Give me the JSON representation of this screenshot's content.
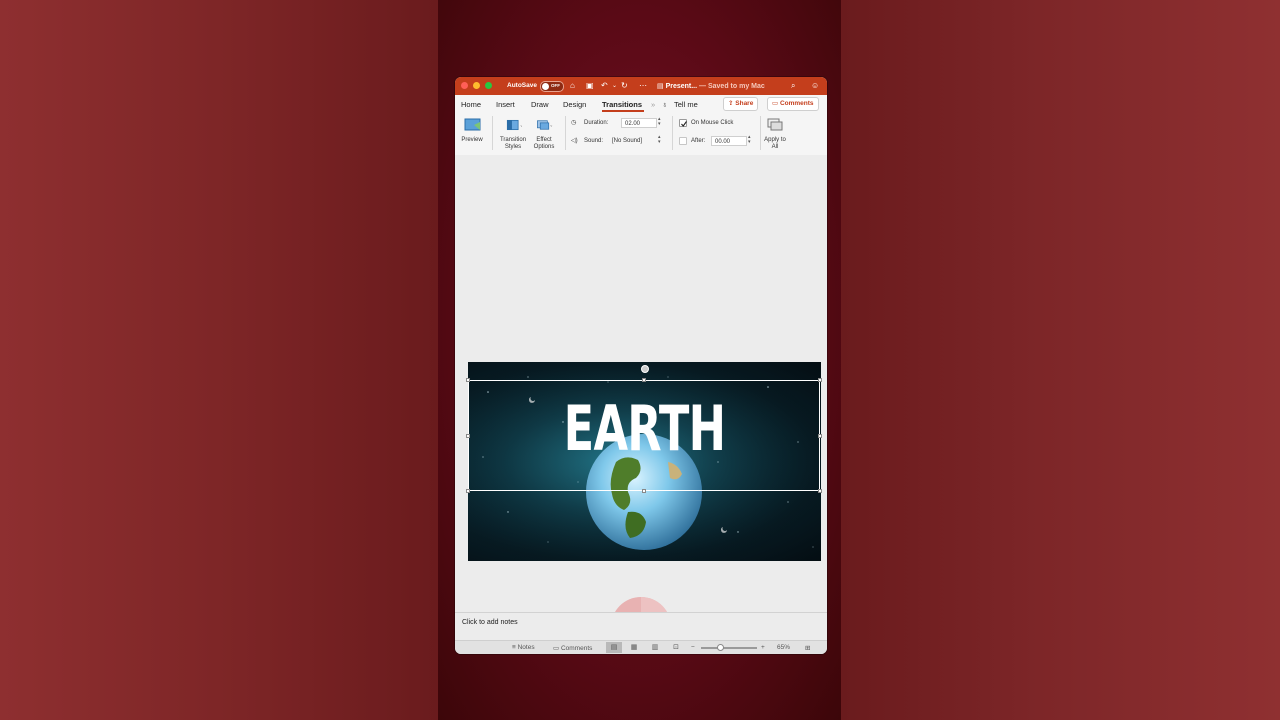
{
  "titlebar": {
    "autosave_label": "AutoSave",
    "autosave_state": "OFF",
    "doc_name": "Present...",
    "save_status": "— Saved to my Mac"
  },
  "tabs": [
    {
      "label": "Home"
    },
    {
      "label": "Insert"
    },
    {
      "label": "Draw"
    },
    {
      "label": "Design"
    },
    {
      "label": "Transitions",
      "active": true
    }
  ],
  "tell_me": "Tell me",
  "share_label": "Share",
  "comments_label": "Comments",
  "ribbon": {
    "preview_label": "Preview",
    "transition_styles_label": "Transition Styles",
    "effect_options_label": "Effect Options",
    "duration_label": "Duration:",
    "duration_value": "02.00",
    "sound_label": "Sound:",
    "sound_value": "[No Sound]",
    "on_mouse_click_label": "On Mouse Click",
    "on_mouse_click_checked": true,
    "after_label": "After:",
    "after_value": "00.00",
    "after_checked": false,
    "apply_all_label": "Apply to All"
  },
  "slide": {
    "title": "EARTH"
  },
  "notes_placeholder": "Click to add notes",
  "statusbar": {
    "notes_label": "Notes",
    "comments_label": "Comments",
    "zoom_minus": "−",
    "zoom_plus": "+",
    "zoom_level": "65%"
  },
  "colors": {
    "accent": "#c43e1c",
    "titlebar": "#c43e1c"
  }
}
